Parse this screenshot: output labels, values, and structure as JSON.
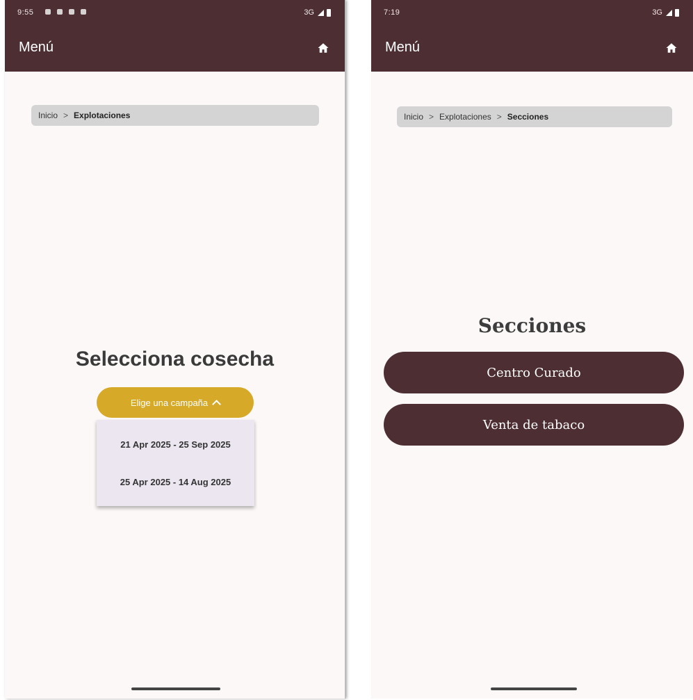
{
  "left_screen": {
    "status": {
      "time": "9:55",
      "network": "3G"
    },
    "appbar": {
      "title": "Menú"
    },
    "breadcrumb": {
      "item1": "Inicio",
      "sep": ">",
      "current": "Explotaciones"
    },
    "heading": "Selecciona cosecha",
    "dropdown": {
      "label": "Elige una campaña",
      "options": [
        "21 Apr 2025 - 25 Sep 2025",
        "25 Apr 2025 - 14 Aug 2025"
      ]
    }
  },
  "right_screen": {
    "status": {
      "time": "7:19",
      "network": "3G"
    },
    "appbar": {
      "title": "Menú"
    },
    "breadcrumb": {
      "item1": "Inicio",
      "sep1": ">",
      "item2": "Explotaciones",
      "sep2": ">",
      "current": "Secciones"
    },
    "heading": "Secciones",
    "sections": [
      "Centro Curado",
      "Venta de tabaco"
    ]
  },
  "colors": {
    "appbar": "#4d2e33",
    "accent": "#d6a928",
    "background": "#fcf8f8"
  },
  "icons": [
    "home-icon",
    "chevron-up-icon",
    "battery-icon",
    "signal-icon"
  ]
}
